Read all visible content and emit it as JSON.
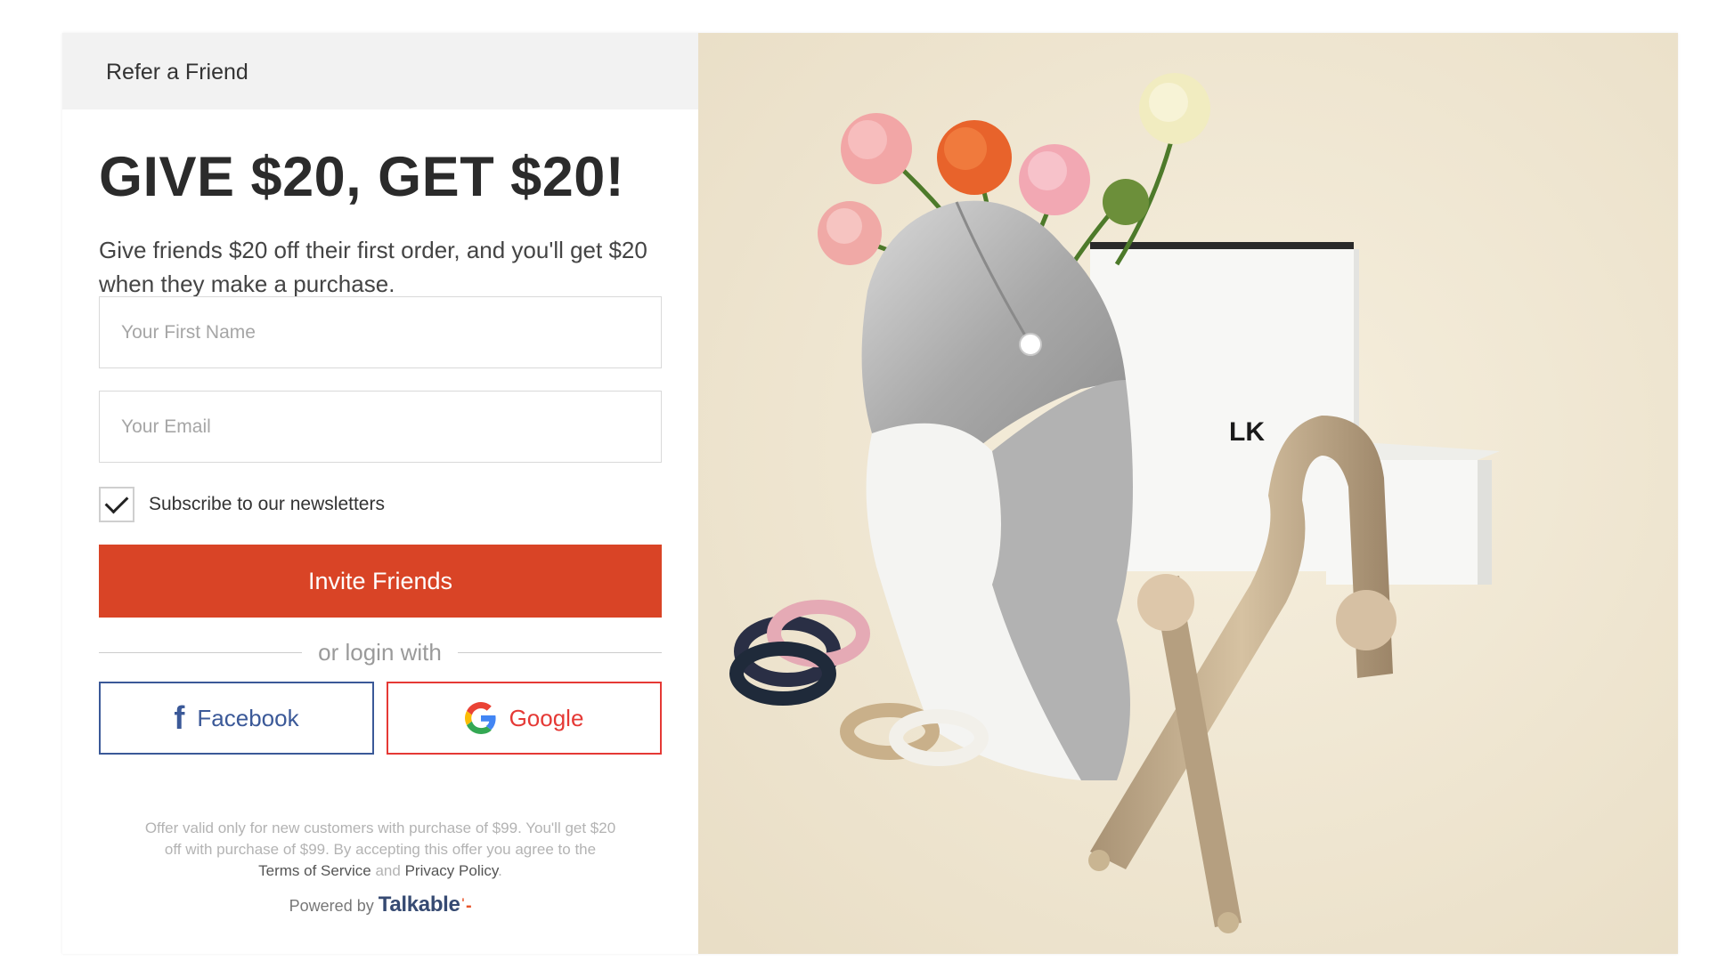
{
  "header": {
    "title": "Refer a Friend"
  },
  "offer": {
    "headline": "GIVE $20, GET $20!",
    "description": "Give friends $20 off their first order, and you'll get $20 when they make a purchase."
  },
  "form": {
    "first_name_placeholder": "Your First Name",
    "first_name_value": "",
    "email_placeholder": "Your Email",
    "email_value": "",
    "newsletter_label": "Subscribe to our newsletters",
    "newsletter_checked": true,
    "invite_button": "Invite Friends"
  },
  "social": {
    "divider_text": "or login with",
    "facebook_label": "Facebook",
    "google_label": "Google",
    "facebook_icon": "facebook-icon",
    "google_icon": "google-icon"
  },
  "legal": {
    "text_before": "Offer valid only for new customers with purchase of $99. You'll get $20 off with purchase of $99. By accepting this offer you agree to the",
    "terms_link": "Terms of Service",
    "and_text": "and",
    "privacy_link": "Privacy Policy",
    "period": "."
  },
  "footer": {
    "powered_by": "Powered by",
    "brand": "Talkable"
  },
  "product_image": {
    "box_text": "LK"
  },
  "colors": {
    "invite_button": "#d94426",
    "facebook": "#3b5998",
    "google": "#e53935",
    "header_bar": "#f2f2f2",
    "photo_background": "#efe7d4"
  }
}
